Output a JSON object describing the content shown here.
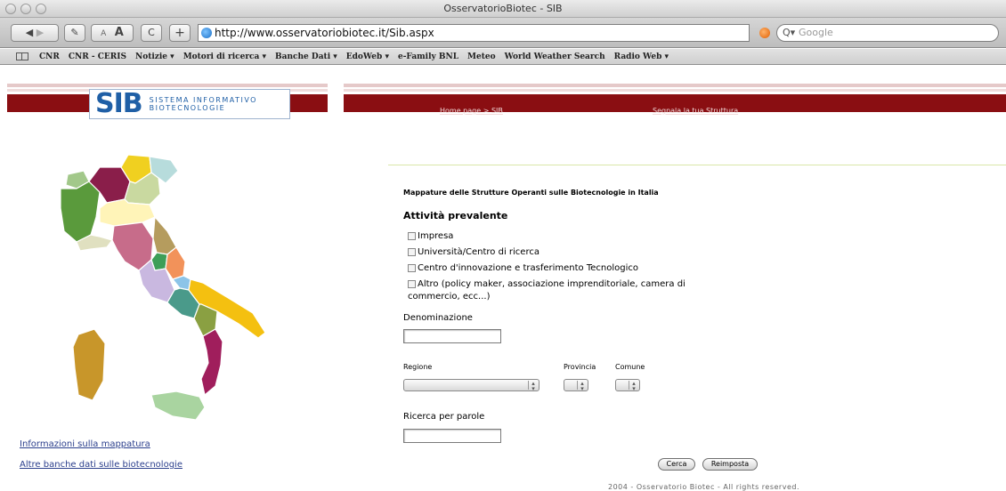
{
  "browser": {
    "window_title": "OsservatorioBiotec - SIB",
    "url": "http://www.osservatoriobiotec.it/Sib.aspx",
    "search_placeholder": "Google",
    "buttons": {
      "back": "◀",
      "forward": "▶",
      "text_smaller": "A",
      "text_bigger": "A",
      "reload": "C",
      "add": "+"
    },
    "bookmarks": [
      "CNR",
      "CNR - CERIS",
      "Notizie ▾",
      "Motori di ricerca ▾",
      "Banche Dati ▾",
      "EdoWeb ▾",
      "e-Family BNL",
      "Meteo",
      "World Weather Search",
      "Radio Web ▾"
    ]
  },
  "header": {
    "logo_mark": "SIB",
    "logo_line1": "SISTEMA INFORMATIVO",
    "logo_line2": "BIOTECNOLOGIE",
    "breadcrumb": "Home page > SIB",
    "report_link": "Segnala la tua Struttura"
  },
  "sidebar": {
    "links": [
      "Informazioni sulla mappatura",
      "Altre banche dati sulle biotecnologie"
    ]
  },
  "form": {
    "title": "Mappature delle Strutture Operanti sulle Biotecnologie in Italia",
    "section_title": "Attività prevalente",
    "checkboxes": [
      "Impresa",
      "Università/Centro di ricerca",
      "Centro d'innovazione e trasferimento Tecnologico",
      "Altro (policy maker, associazione imprenditoriale, camera di commercio, ecc...)"
    ],
    "denominazione_label": "Denominazione",
    "regione_label": "Regione",
    "provincia_label": "Provincia",
    "comune_label": "Comune",
    "keywords_label": "Ricerca per parole",
    "search_button": "Cerca",
    "reset_button": "Reimposta"
  },
  "footer": "2004 - Osservatorio Biotec - All rights reserved.",
  "colors": {
    "brand_red": "#8a0e12",
    "brand_blue": "#1f5fa6",
    "link_blue": "#2a3e8c"
  }
}
